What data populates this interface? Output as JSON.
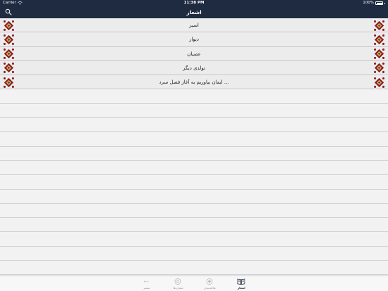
{
  "status_bar": {
    "carrier": "Carrier",
    "time": "11:38 PM",
    "battery": "100%"
  },
  "nav": {
    "title": "اشعار",
    "search_icon": "search-icon"
  },
  "poems": [
    {
      "title": "اسیر"
    },
    {
      "title": "دیوار"
    },
    {
      "title": "عصیان"
    },
    {
      "title": "تولدی دیگر"
    },
    {
      "title": "ایمان بیاوریم به آغاز فصل سرد ..."
    }
  ],
  "tabs": [
    {
      "label": "بیشتر",
      "icon": "more-icon",
      "active": false
    },
    {
      "label": "شماره‌ها",
      "icon": "disc-icon",
      "active": false
    },
    {
      "label": "علاقه‌مندی",
      "icon": "heart-icon",
      "active": false
    },
    {
      "label": "اشعار",
      "icon": "book-icon",
      "active": true
    }
  ],
  "colors": {
    "nav_bg": "#1e2b40",
    "list_bg": "#ececec",
    "active_tab": "#1e2b40"
  }
}
